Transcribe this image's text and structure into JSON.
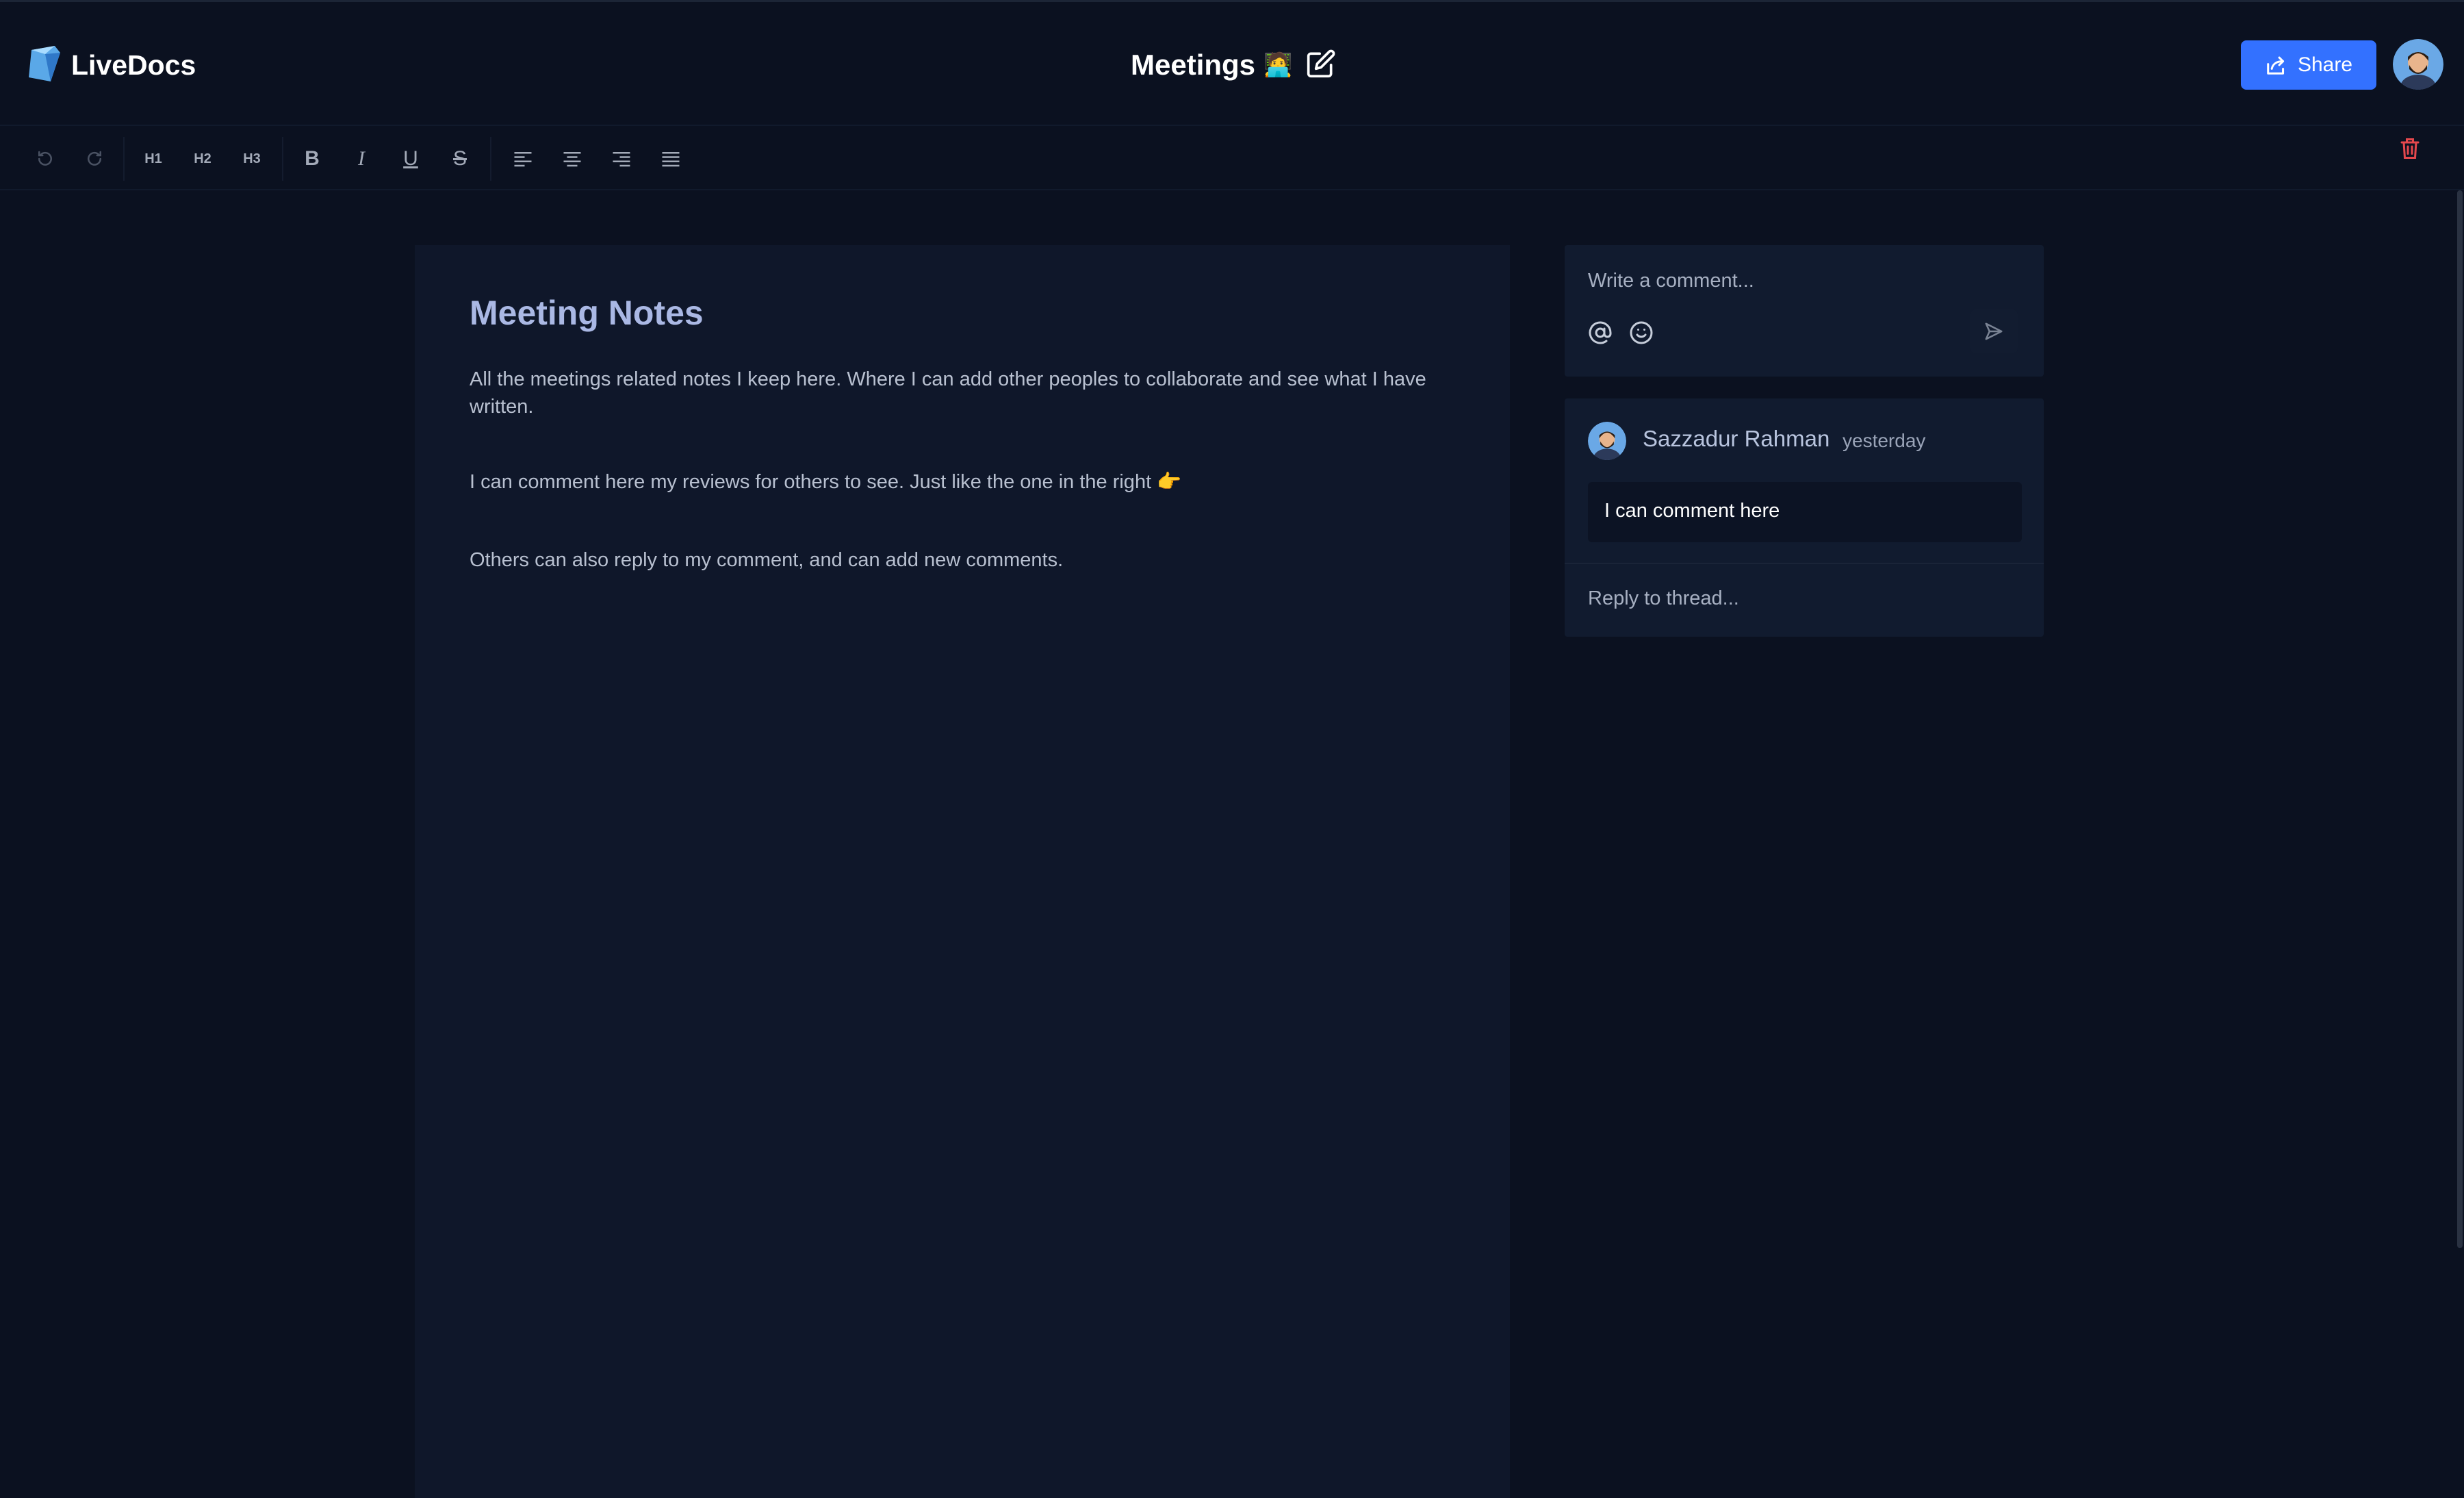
{
  "app": {
    "name": "LiveDocs"
  },
  "header": {
    "doc_title": "Meetings",
    "title_emoji": "🧑‍💻",
    "share_label": "Share"
  },
  "toolbar": {
    "undo_icon": "undo-icon",
    "redo_icon": "redo-icon",
    "h1": "H1",
    "h2": "H2",
    "h3": "H3",
    "bold": "B",
    "italic": "I",
    "underline": "U",
    "strike": "S",
    "align_icons": [
      "align-left-icon",
      "align-center-icon",
      "align-right-icon",
      "align-justify-icon"
    ],
    "delete_icon": "trash-icon"
  },
  "editor": {
    "heading": "Meeting Notes",
    "paragraphs": [
      "All the meetings related notes I keep here. Where I can add other peoples to collaborate and see what I have written.",
      "I can comment here my reviews for others to see. Just like the one in the right  👉",
      "Others can also reply to my comment, and can add new comments."
    ]
  },
  "comment_composer": {
    "placeholder": "Write a comment..."
  },
  "thread": {
    "author": "Sazzadur Rahman",
    "time": "yesterday",
    "body": "I can comment here",
    "reply_placeholder": "Reply to thread..."
  },
  "colors": {
    "background": "#0b1120",
    "panel": "#111b2f",
    "accent": "#3371ff",
    "danger": "#e5484d"
  }
}
